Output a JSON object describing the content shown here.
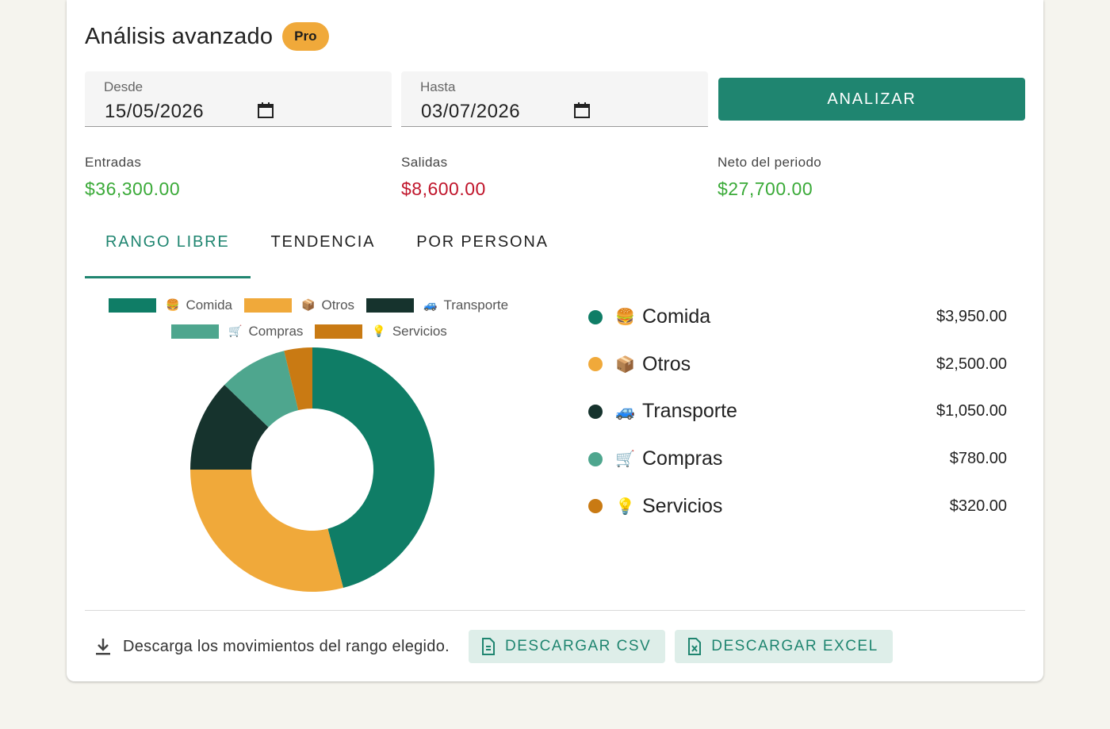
{
  "header": {
    "title": "Análisis avanzado",
    "badge": "Pro"
  },
  "filters": {
    "from": {
      "label": "Desde",
      "value": "15/05/2026",
      "icon": "calendar-icon"
    },
    "to": {
      "label": "Hasta",
      "value": "03/07/2026",
      "icon": "calendar-icon"
    },
    "analyze_label": "ANALIZAR"
  },
  "stats": {
    "income": {
      "label": "Entradas",
      "value": "$36,300.00",
      "color": "#3aaa38"
    },
    "expenses": {
      "label": "Salidas",
      "value": "$8,600.00",
      "color": "#c0152b"
    },
    "net": {
      "label": "Neto del periodo",
      "value": "$27,700.00",
      "color": "#3aaa38"
    }
  },
  "tabs": [
    {
      "label": "RANGO LIBRE",
      "active": true
    },
    {
      "label": "TENDENCIA",
      "active": false
    },
    {
      "label": "POR PERSONA",
      "active": false
    }
  ],
  "categories": [
    {
      "emoji": "🍔",
      "name": "Comida",
      "amount": "$3,950.00",
      "value": 3950,
      "color": "#0f7d66"
    },
    {
      "emoji": "📦",
      "name": "Otros",
      "amount": "$2,500.00",
      "value": 2500,
      "color": "#f0a93a"
    },
    {
      "emoji": "🚙",
      "name": "Transporte",
      "amount": "$1,050.00",
      "value": 1050,
      "color": "#16332d"
    },
    {
      "emoji": "🛒",
      "name": "Compras",
      "amount": "$780.00",
      "value": 780,
      "color": "#4ea68e"
    },
    {
      "emoji": "💡",
      "name": "Servicios",
      "amount": "$320.00",
      "value": 320,
      "color": "#c97a13"
    }
  ],
  "chart_data": {
    "type": "pie",
    "categories": [
      "🍔 Comida",
      "📦 Otros",
      "🚙 Transporte",
      "🛒 Compras",
      "💡 Servicios"
    ],
    "values": [
      3950,
      2500,
      1050,
      780,
      320
    ],
    "colors": [
      "#0f7d66",
      "#f0a93a",
      "#16332d",
      "#4ea68e",
      "#c97a13"
    ],
    "legend": "top"
  },
  "footer": {
    "text": "Descarga los movimientos del rango elegido.",
    "csv_label": "DESCARGAR CSV",
    "excel_label": "DESCARGAR EXCEL",
    "download_icon": "download-icon",
    "csv_icon": "csv-file-icon",
    "excel_icon": "excel-file-icon"
  },
  "colors": {
    "accent": "#1f8570",
    "badge": "#f0a93a"
  }
}
